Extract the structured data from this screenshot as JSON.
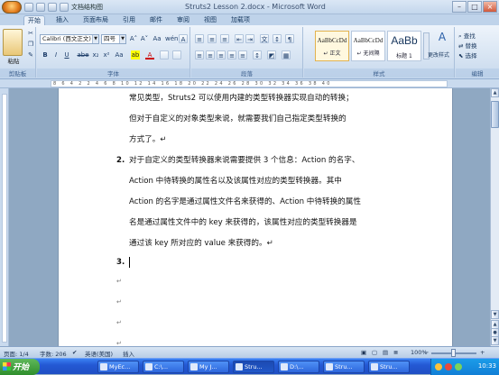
{
  "window": {
    "title": "Struts2 Lesson 2.docx - Microsoft Word",
    "qat_label": "文档结构图",
    "controls": {
      "min": "–",
      "max": "□",
      "close": "×"
    }
  },
  "ribbon": {
    "tabs": [
      "开始",
      "插入",
      "页面布局",
      "引用",
      "邮件",
      "审阅",
      "视图",
      "加载项"
    ],
    "active_tab": "开始",
    "clipboard": {
      "paste_label": "粘贴",
      "group_label": "剪贴板"
    },
    "font": {
      "name": "Calibri (西文正文)",
      "size": "四号",
      "group_label": "字体",
      "bold": "B",
      "italic": "I",
      "underline": "U",
      "strike": "abe",
      "sub": "x₂",
      "sup": "x²",
      "clear": "Aa",
      "highlight": "ab",
      "color": "A",
      "grow": "A˄",
      "shrink": "A˅",
      "phonetic": "wén",
      "border": "A"
    },
    "paragraph": {
      "group_label": "段落"
    },
    "styles": {
      "group_label": "样式",
      "items": [
        {
          "sample": "AaBbCcDd",
          "name": "↵ 正文"
        },
        {
          "sample": "AaBbCcDd",
          "name": "↵ 无间隔"
        },
        {
          "sample": "AaBb",
          "name": "标题 1"
        }
      ],
      "change_styles": "更改样式"
    },
    "editing": {
      "group_label": "编辑",
      "find": "查找",
      "replace": "替换",
      "select": "选择"
    }
  },
  "ruler": {
    "numbers": "8 6 4 2  2 4 6 8 10 12 14 16 18 20 22 24 26 28 30 32 34 36 38 40"
  },
  "document": {
    "lines": [
      "常见类型，Struts2 可以使用内建的类型转换器实现自动的转换；",
      "但对于自定义的对象类型来说，就需要我们自己指定类型转换的",
      "方式了。↵"
    ],
    "item2_number": "2.",
    "item2_lines": [
      "对于自定义的类型转换器来说需要提供 3 个信息：Action 的名字、",
      "Action  中待转换的属性名以及该属性对应的类型转换器。其中",
      "Action 的名字是通过属性文件名来获得的、Action 中待转换的属性",
      "名是通过属性文件中的 key 来获得的，该属性对应的类型转换器是",
      "通过该 key 所对应的 value 来获得的。↵"
    ],
    "item3_number": "3.",
    "pilcrow": "↵"
  },
  "statusbar": {
    "page": "页面: 1/4",
    "words": "字数: 206",
    "language": "英语(美国)",
    "mode": "插入",
    "zoom": "100%"
  },
  "taskbar": {
    "start": "开始",
    "tasks": [
      "MyEc...",
      "C:\\...",
      "My J...",
      "Stru...",
      "D:\\...",
      "Stru...",
      "Stru..."
    ],
    "clock": "10:33"
  }
}
